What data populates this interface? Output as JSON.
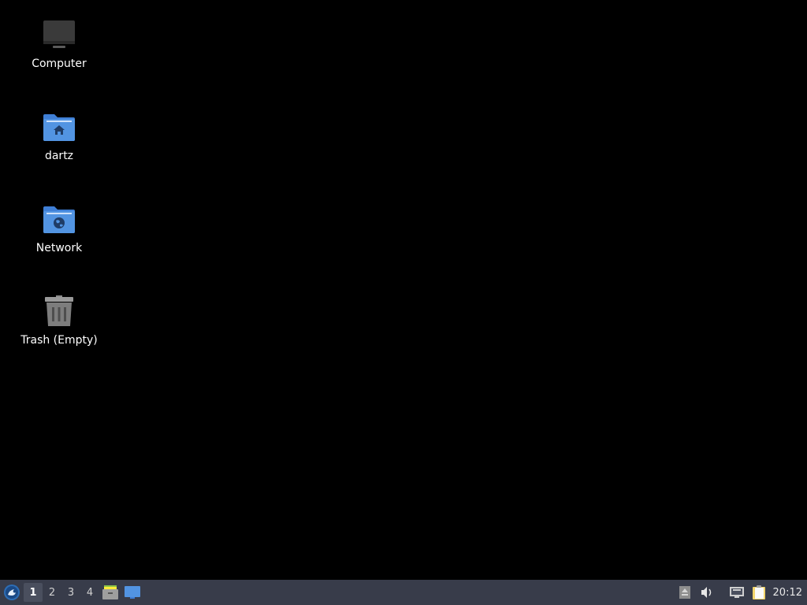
{
  "desktop": {
    "icons": [
      {
        "label": "Computer",
        "icon": "computer-icon"
      },
      {
        "label": "dartz",
        "icon": "home-folder-icon"
      },
      {
        "label": "Network",
        "icon": "network-folder-icon"
      },
      {
        "label": "Trash (Empty)",
        "icon": "trash-icon"
      }
    ]
  },
  "panel": {
    "menu_icon": "xfce-menu-icon",
    "workspaces": [
      "1",
      "2",
      "3",
      "4"
    ],
    "active_workspace": "1",
    "launchers": [
      "file-manager-icon",
      "show-desktop-icon"
    ],
    "tray": [
      "removable-media-icon",
      "volume-icon",
      "network-wired-icon",
      "clipboard-icon"
    ],
    "clock": "20:12"
  },
  "colors": {
    "desktop_bg": "#000000",
    "panel_bg": "#383c4a",
    "folder_blue": "#5294e2"
  }
}
